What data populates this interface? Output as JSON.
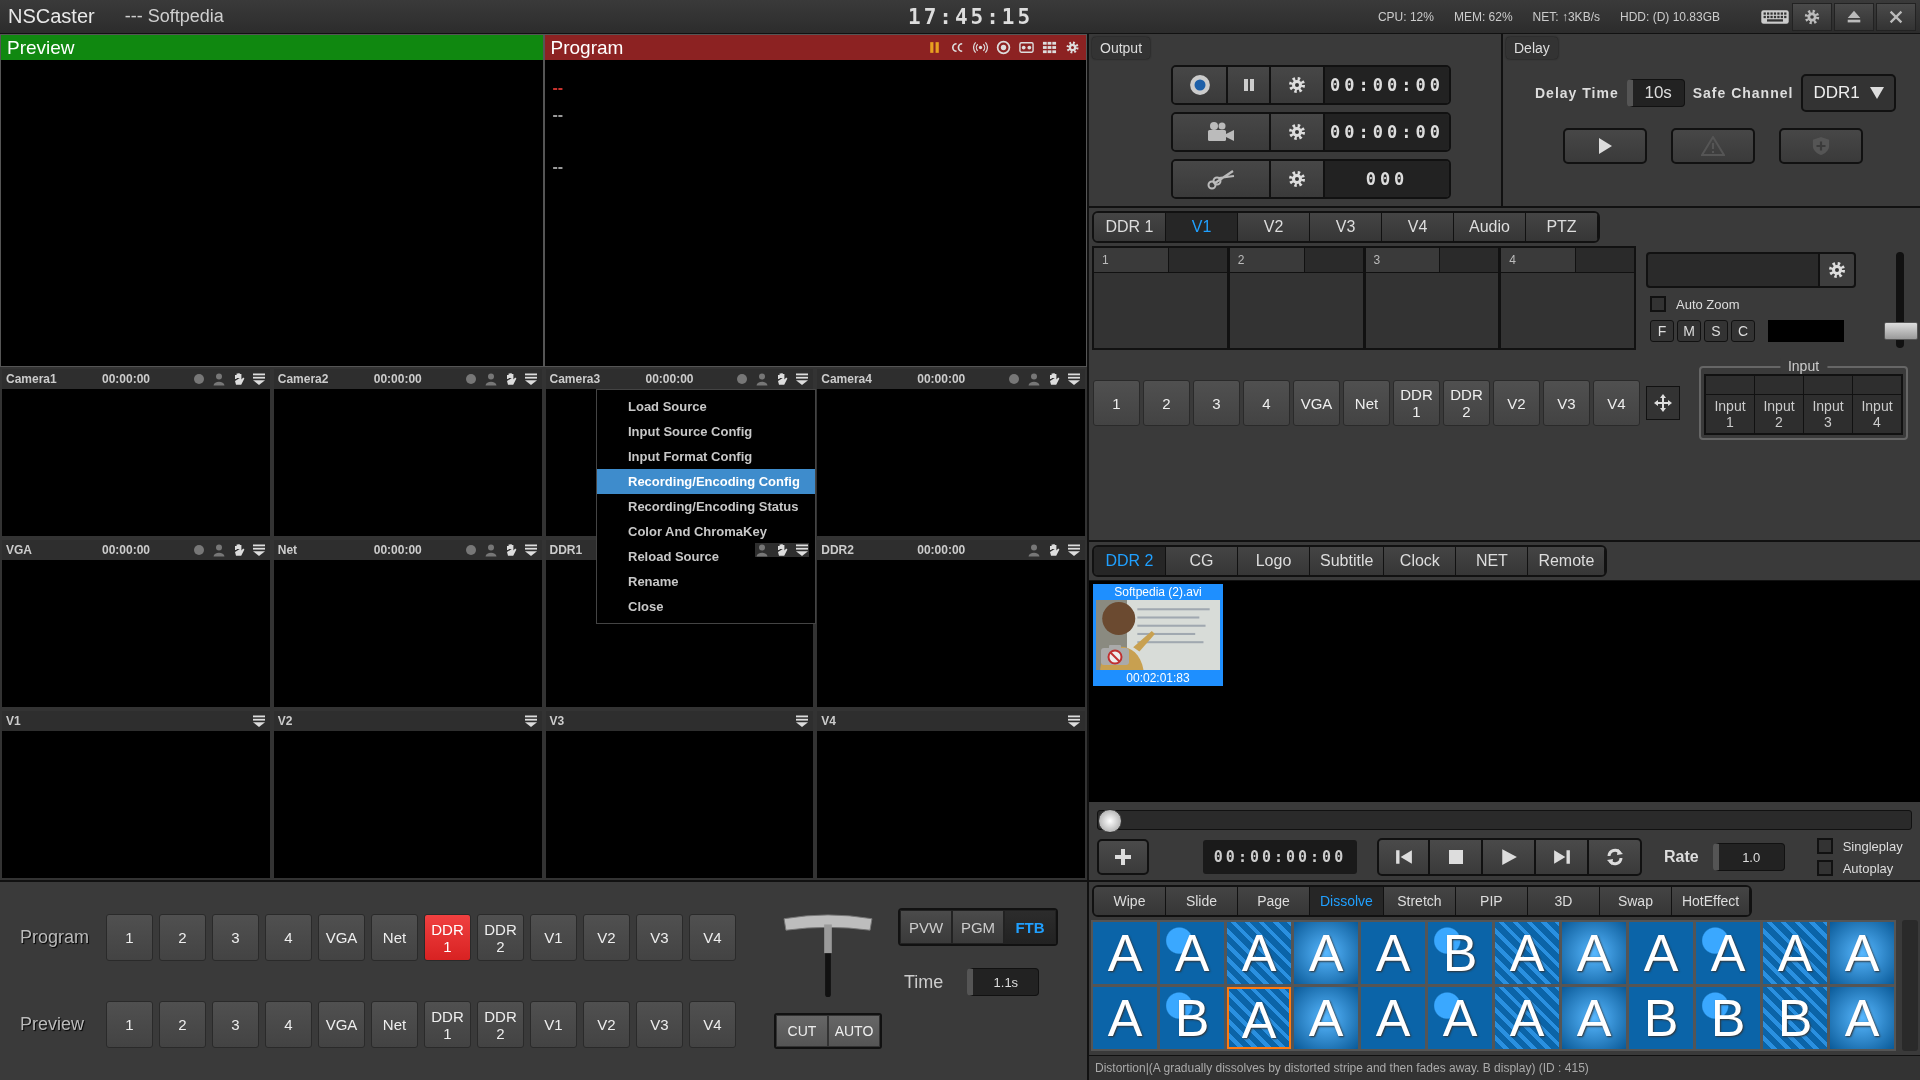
{
  "title_bar": {
    "app_name": "NSCaster",
    "subtitle": "--- Softpedia",
    "clock": "17:45:15",
    "stats": [
      "CPU: 12%",
      "MEM: 62%",
      "NET: ↑3KB/s",
      "HDD: (D) 10.83GB"
    ]
  },
  "preview_header": {
    "title": "Preview"
  },
  "program_header": {
    "title": "Program"
  },
  "program_marks": [
    {
      "text": "--",
      "color": "#c8322d"
    },
    {
      "text": "--",
      "color": "#9a9a9a"
    },
    {
      "text": "--",
      "color": "#9a9a9a"
    }
  ],
  "sources": [
    {
      "name": "Camera1",
      "time": "00:00:00",
      "kind": "live"
    },
    {
      "name": "Camera2",
      "time": "00:00:00",
      "kind": "live"
    },
    {
      "name": "Camera3",
      "time": "00:00:00",
      "kind": "live"
    },
    {
      "name": "Camera4",
      "time": "00:00:00",
      "kind": "live"
    },
    {
      "name": "VGA",
      "time": "00:00:00",
      "kind": "live"
    },
    {
      "name": "Net",
      "time": "00:00:00",
      "kind": "live"
    },
    {
      "name": "DDR1",
      "kind": "ddr"
    },
    {
      "name": "DDR2",
      "time": "00:00:00",
      "kind": "ddr"
    },
    {
      "name": "V1",
      "kind": "virtual"
    },
    {
      "name": "V2",
      "kind": "virtual"
    },
    {
      "name": "V3",
      "kind": "virtual"
    },
    {
      "name": "V4",
      "kind": "virtual"
    }
  ],
  "context_menu": [
    {
      "label": "Load Source",
      "selected": false
    },
    {
      "label": "Input Source Config",
      "selected": false
    },
    {
      "label": "Input Format Config",
      "selected": false
    },
    {
      "label": "Recording/Encoding Config",
      "selected": true
    },
    {
      "label": "Recording/Encoding Status",
      "selected": false
    },
    {
      "label": "Color And ChromaKey",
      "selected": false
    },
    {
      "label": "Reload Source",
      "selected": false
    },
    {
      "label": "Rename",
      "selected": false
    },
    {
      "label": "Close",
      "selected": false
    }
  ],
  "output": {
    "title": "Output",
    "rows": [
      {
        "kind": "record",
        "reading": "00:00:00"
      },
      {
        "kind": "camera",
        "reading": "00:00:00"
      },
      {
        "kind": "clip",
        "reading": "000"
      }
    ]
  },
  "delay": {
    "title": "Delay",
    "delay_label": "Delay Time",
    "delay_value": "10s",
    "safe_label": "Safe Channel",
    "safe_value": "DDR1"
  },
  "source_tabs": [
    {
      "label": "DDR 1",
      "selected": false
    },
    {
      "label": "V1",
      "selected": true
    },
    {
      "label": "V2",
      "selected": false
    },
    {
      "label": "V3",
      "selected": false
    },
    {
      "label": "V4",
      "selected": false
    },
    {
      "label": "Audio",
      "selected": false
    },
    {
      "label": "PTZ",
      "selected": false
    }
  ],
  "slots": [
    "1",
    "2",
    "3",
    "4"
  ],
  "auto_zoom": {
    "label": "Auto Zoom",
    "checked": false
  },
  "zoom_buttons": [
    "F",
    "M",
    "S",
    "C"
  ],
  "zoom_slider": {
    "level": 0.1
  },
  "v_buttons": [
    "1",
    "2",
    "3",
    "4",
    "VGA",
    "Net",
    "DDR\n1",
    "DDR\n2",
    "V2",
    "V3",
    "V4"
  ],
  "input_group": {
    "legend": "Input",
    "inputs": [
      "Input\n1",
      "Input\n2",
      "Input\n3",
      "Input\n4"
    ]
  },
  "media_tabs": [
    {
      "label": "DDR 2",
      "selected": true
    },
    {
      "label": "CG",
      "selected": false
    },
    {
      "label": "Logo",
      "selected": false
    },
    {
      "label": "Subtitle",
      "selected": false
    },
    {
      "label": "Clock",
      "selected": false
    },
    {
      "label": "NET",
      "selected": false
    },
    {
      "label": "Remote",
      "selected": false
    }
  ],
  "media_items": [
    {
      "name": "Softpedia (2).avi",
      "duration": "00:02:01:83",
      "selected": true
    }
  ],
  "scrubber": {
    "level": 0
  },
  "timecode": "00:00:00:00",
  "rate": {
    "label": "Rate",
    "value": "1.0"
  },
  "play_options": [
    {
      "label": "Singleplay",
      "checked": false
    },
    {
      "label": "Autoplay",
      "checked": false
    }
  ],
  "switcher": {
    "rows": [
      {
        "label": "Program",
        "buttons": [
          {
            "label": "1",
            "selected": false
          },
          {
            "label": "2",
            "selected": false
          },
          {
            "label": "3",
            "selected": false
          },
          {
            "label": "4",
            "selected": false
          },
          {
            "label": "VGA",
            "selected": false
          },
          {
            "label": "Net",
            "selected": false
          },
          {
            "label": "DDR\n1",
            "selected": true
          },
          {
            "label": "DDR\n2",
            "selected": false
          },
          {
            "label": "V1",
            "selected": false
          },
          {
            "label": "V2",
            "selected": false
          },
          {
            "label": "V3",
            "selected": false
          },
          {
            "label": "V4",
            "selected": false
          }
        ]
      },
      {
        "label": "Preview",
        "buttons": [
          {
            "label": "1",
            "selected": false
          },
          {
            "label": "2",
            "selected": false
          },
          {
            "label": "3",
            "selected": false
          },
          {
            "label": "4",
            "selected": false
          },
          {
            "label": "VGA",
            "selected": false
          },
          {
            "label": "Net",
            "selected": false
          },
          {
            "label": "DDR\n1",
            "selected": false
          },
          {
            "label": "DDR\n2",
            "selected": false
          },
          {
            "label": "V1",
            "selected": false
          },
          {
            "label": "V2",
            "selected": false
          },
          {
            "label": "V3",
            "selected": false
          },
          {
            "label": "V4",
            "selected": false
          }
        ]
      }
    ],
    "modes": [
      {
        "label": "PVW",
        "selected": false
      },
      {
        "label": "PGM",
        "selected": false
      },
      {
        "label": "FTB",
        "selected": true
      }
    ],
    "time_label": "Time",
    "time_value": "1.1s",
    "cut": "CUT",
    "auto": "AUTO"
  },
  "transition_tabs": [
    {
      "label": "Wipe",
      "selected": false
    },
    {
      "label": "Slide",
      "selected": false
    },
    {
      "label": "Page",
      "selected": false
    },
    {
      "label": "Dissolve",
      "selected": true
    },
    {
      "label": "Stretch",
      "selected": false
    },
    {
      "label": "PIP",
      "selected": false
    },
    {
      "label": "3D",
      "selected": false
    },
    {
      "label": "Swap",
      "selected": false
    },
    {
      "label": "HotEffect",
      "selected": false
    }
  ],
  "effects": [
    {
      "letter": "A",
      "selected": false
    },
    {
      "letter": "A",
      "selected": false
    },
    {
      "letter": "A",
      "selected": false
    },
    {
      "letter": "A",
      "selected": false
    },
    {
      "letter": "A",
      "selected": false
    },
    {
      "letter": "B",
      "selected": false
    },
    {
      "letter": "A",
      "selected": false
    },
    {
      "letter": "A",
      "selected": false
    },
    {
      "letter": "A",
      "selected": false
    },
    {
      "letter": "A",
      "selected": false
    },
    {
      "letter": "A",
      "selected": false
    },
    {
      "letter": "A",
      "selected": false
    },
    {
      "letter": "A",
      "selected": false
    },
    {
      "letter": "B",
      "selected": false
    },
    {
      "letter": "A",
      "selected": true
    },
    {
      "letter": "A",
      "selected": false
    },
    {
      "letter": "A",
      "selected": false
    },
    {
      "letter": "A",
      "selected": false
    },
    {
      "letter": "A",
      "selected": false
    },
    {
      "letter": "A",
      "selected": false
    },
    {
      "letter": "B",
      "selected": false
    },
    {
      "letter": "B",
      "selected": false
    },
    {
      "letter": "B",
      "selected": false
    },
    {
      "letter": "A",
      "selected": false
    }
  ],
  "status": "Distortion|(A gradually dissolves by distorted stripe and then fades away. B display) (ID : 415)"
}
